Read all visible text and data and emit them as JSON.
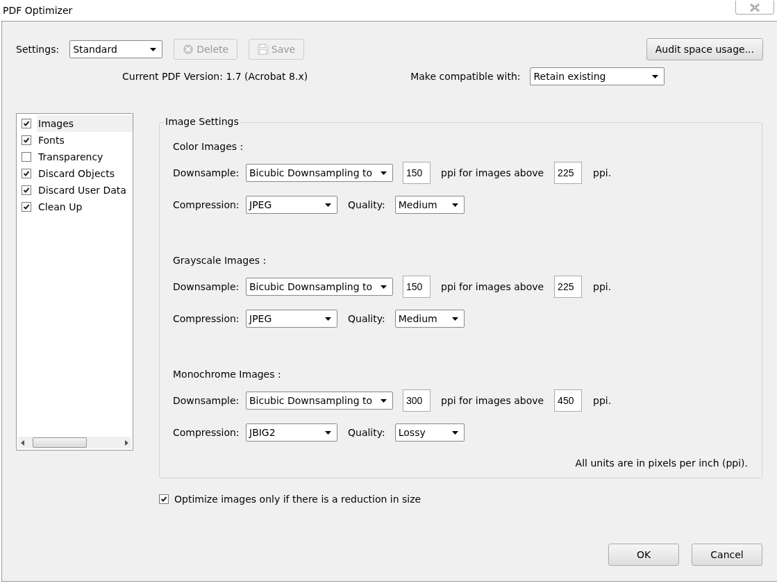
{
  "window": {
    "title": "PDF Optimizer"
  },
  "settings": {
    "label": "Settings:",
    "value": "Standard"
  },
  "toolbar_buttons": [
    {
      "kind": "delete",
      "label": "Delete",
      "disabled": true
    },
    {
      "kind": "save",
      "label": "Save",
      "disabled": true
    }
  ],
  "audit_button": {
    "label": "Audit space usage..."
  },
  "version_text": "Current PDF Version: 1.7 (Acrobat 8.x)",
  "compatibility": {
    "label": "Make compatible with:",
    "value": "Retain existing"
  },
  "panel_list": [
    {
      "label": "Images",
      "checked": true,
      "selected": true
    },
    {
      "label": "Fonts",
      "checked": true,
      "selected": false
    },
    {
      "label": "Transparency",
      "checked": false,
      "selected": false
    },
    {
      "label": "Discard Objects",
      "checked": true,
      "selected": false
    },
    {
      "label": "Discard User Data",
      "checked": true,
      "selected": false
    },
    {
      "label": "Clean Up",
      "checked": true,
      "selected": false
    }
  ],
  "image_settings": {
    "title": "Image Settings",
    "sections": [
      {
        "title": "Color Images :",
        "downsample_label": "Downsample:",
        "method": "Bicubic Downsampling to",
        "ppi": "150",
        "above_label": "ppi for images above",
        "threshold": "225",
        "unit": "ppi.",
        "compression_label": "Compression:",
        "compression": "JPEG",
        "quality_label": "Quality:",
        "quality": "Medium"
      },
      {
        "title": "Grayscale Images :",
        "downsample_label": "Downsample:",
        "method": "Bicubic Downsampling to",
        "ppi": "150",
        "above_label": "ppi for images above",
        "threshold": "225",
        "unit": "ppi.",
        "compression_label": "Compression:",
        "compression": "JPEG",
        "quality_label": "Quality:",
        "quality": "Medium"
      },
      {
        "title": "Monochrome Images :",
        "downsample_label": "Downsample:",
        "method": "Bicubic Downsampling to",
        "ppi": "300",
        "above_label": "ppi for images above",
        "threshold": "450",
        "unit": "ppi.",
        "compression_label": "Compression:",
        "compression": "JBIG2",
        "quality_label": "Quality:",
        "quality": "Lossy"
      }
    ],
    "note": "All units are in pixels per inch (ppi)."
  },
  "optimize_checkbox": {
    "label": "Optimize images only if there is a reduction in size",
    "checked": true
  },
  "buttons": [
    {
      "label": "OK"
    },
    {
      "label": "Cancel"
    }
  ]
}
